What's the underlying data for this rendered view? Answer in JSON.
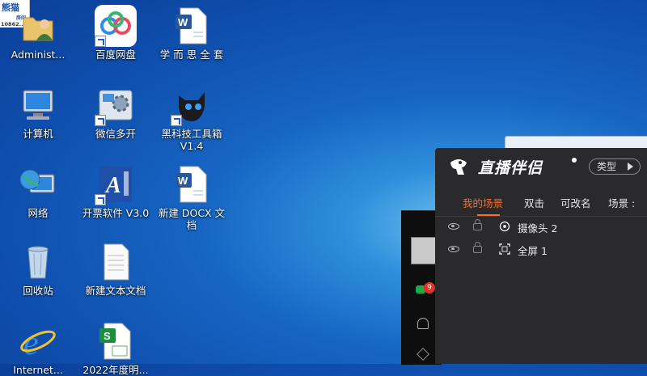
{
  "corner_logo": {
    "line1": "熊猫",
    "line2": "房间",
    "number": "10862..."
  },
  "desktop_icons": [
    {
      "id": "administrator",
      "label": "Administ...",
      "icon": "user-folder-icon"
    },
    {
      "id": "baidu-netdisk",
      "label": "百度网盘",
      "icon": "cloud-icon"
    },
    {
      "id": "xueersi",
      "label": "学 而 思 全 套",
      "icon": "word-doc-icon"
    },
    {
      "id": "computer",
      "label": "计算机",
      "icon": "computer-icon"
    },
    {
      "id": "wechat-multi",
      "label": "微信多开",
      "icon": "gear-installer-icon"
    },
    {
      "id": "black-tech",
      "label": "黑科技工具箱 V1.4",
      "icon": "cat-icon"
    },
    {
      "id": "network",
      "label": "网络",
      "icon": "network-globe-icon"
    },
    {
      "id": "invoice",
      "label": "开票软件 V3.0",
      "icon": "invoice-app-icon"
    },
    {
      "id": "new-docx",
      "label": "新建 DOCX 文档",
      "icon": "word-doc-icon"
    },
    {
      "id": "recycle-bin",
      "label": "回收站",
      "icon": "recycle-bin-icon"
    },
    {
      "id": "new-txt",
      "label": "新建文本文档",
      "icon": "text-file-icon"
    },
    {
      "id": "ie",
      "label": "Internet...",
      "icon": "ie-icon"
    },
    {
      "id": "sheet",
      "label": "2022年度明...",
      "icon": "spreadsheet-icon"
    }
  ],
  "back_window": {
    "badge_count": "9"
  },
  "live_panel": {
    "title": "直播伴侣",
    "type_button": "类型",
    "tabs": [
      {
        "label": "我的场景",
        "active": true
      },
      {
        "label": "双击",
        "active": false
      },
      {
        "label": "可改名",
        "active": false
      },
      {
        "label": "场景 :",
        "active": false
      }
    ],
    "scenes": [
      {
        "name": "摄像头 2",
        "icon": "camera-source-icon"
      },
      {
        "name": "全屏 1",
        "icon": "fullscreen-source-icon"
      }
    ],
    "colors": {
      "panel_bg": "#2a2a2d",
      "accent": "#ff6b2c"
    }
  }
}
